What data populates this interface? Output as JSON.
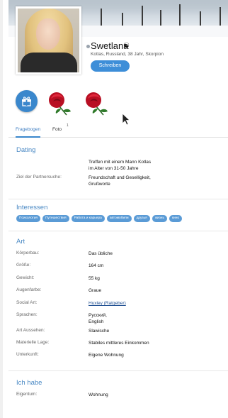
{
  "profile": {
    "name": "Swetlana",
    "name_symbol": "☯",
    "subinfo": "Kotlas, Russland, 38 Jahr, Skorpion",
    "write_button": "Schreiben"
  },
  "tabs": [
    {
      "label": "Fragebogen",
      "active": true
    },
    {
      "label": "Foto",
      "count": "1",
      "active": false
    }
  ],
  "dating": {
    "title": "Dating",
    "rows": [
      {
        "label": "",
        "value_lines": [
          "Treffen mit einem Mann Kotlas",
          "im Alter von 31-50 Jahre"
        ]
      },
      {
        "label": "Ziel der Partnersuche:",
        "value_lines": [
          "Freundschaft und Geselligkeit,",
          "Grußworte"
        ]
      }
    ]
  },
  "interessen": {
    "title": "Interessen",
    "tags": [
      "Психология",
      "Путешествия",
      "Работа и карьера",
      "автомобили",
      "друзья",
      "жизнь",
      "кино"
    ]
  },
  "art": {
    "title": "Art",
    "rows": [
      {
        "label": "Körperbau:",
        "value_lines": [
          "Das übliche"
        ]
      },
      {
        "label": "Größe:",
        "value_lines": [
          "164 cm"
        ]
      },
      {
        "label": "Gewicht:",
        "value_lines": [
          "55 kg"
        ]
      },
      {
        "label": "Augenfarbe:",
        "value_lines": [
          "Graue"
        ]
      },
      {
        "label": "Social Art:",
        "value_lines": [
          "Huxley (Ratgeber)"
        ],
        "link": true
      },
      {
        "label": "Sprachen:",
        "value_lines": [
          "Русский,",
          "English"
        ]
      },
      {
        "label": "Art Aussehen:",
        "value_lines": [
          "Slawische"
        ]
      },
      {
        "label": "Materielle Lage:",
        "value_lines": [
          "Stabiles mittleres Einkommen"
        ]
      },
      {
        "label": "Unterkunft:",
        "value_lines": [
          "Eigene Wohnung"
        ]
      }
    ]
  },
  "ich_habe": {
    "title": "Ich habe",
    "rows": [
      {
        "label": "Eigentum:",
        "value_lines": [
          "Wohnung"
        ]
      }
    ]
  },
  "colors": {
    "accent": "#3a87cc",
    "section_title": "#4a89c4",
    "tag": "#5a9bd6",
    "rose": "#c8102e"
  },
  "icons": {
    "gift": "gift-icon",
    "rose": "rose-icon",
    "cursor": "mouse-cursor-icon",
    "online": "online-status-dot"
  }
}
